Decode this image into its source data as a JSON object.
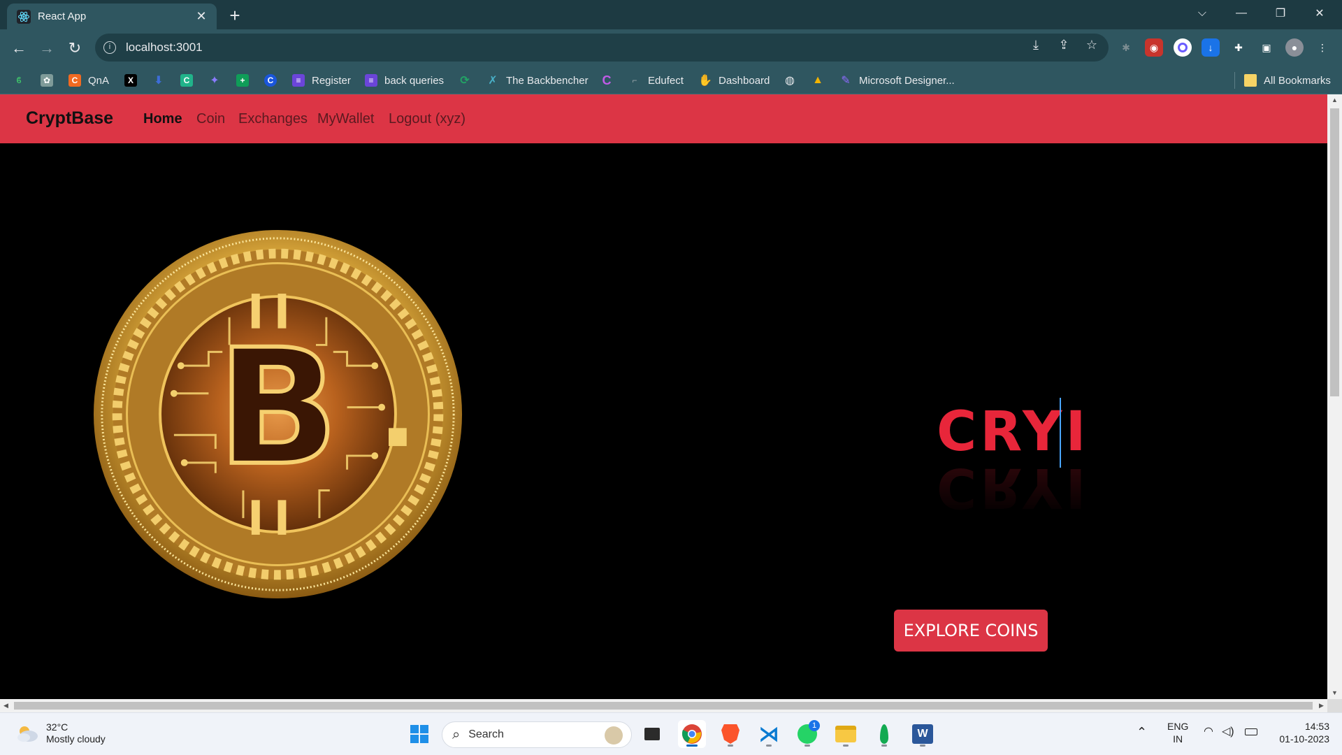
{
  "browser": {
    "tab_title": "React App",
    "url": "localhost:3001",
    "new_tab_symbol": "+",
    "bookmarks": [
      {
        "label": "",
        "icon": "leaf-icon",
        "color": "#3fbf6a"
      },
      {
        "label": "",
        "icon": "chatgpt-icon",
        "color": "#7f9b99"
      },
      {
        "label": "QnA",
        "icon": "c-orange-icon",
        "color": "#f26a21"
      },
      {
        "label": "",
        "icon": "x-icon",
        "color": "#000000"
      },
      {
        "label": "",
        "icon": "download-arrow-icon",
        "color": "#3d6dd8"
      },
      {
        "label": "",
        "icon": "c-green-icon",
        "color": "#21b38a"
      },
      {
        "label": "",
        "icon": "sparkle-icon",
        "color": "#8a7bff"
      },
      {
        "label": "",
        "icon": "sheet-plus-icon",
        "color": "#0f9d58"
      },
      {
        "label": "",
        "icon": "c-blue-icon",
        "color": "#1a56db"
      },
      {
        "label": "Register",
        "icon": "form-icon",
        "color": "#6b45d9"
      },
      {
        "label": "back queries",
        "icon": "form-icon",
        "color": "#6b45d9"
      },
      {
        "label": "",
        "icon": "refresh-green-icon",
        "color": "#22a565"
      },
      {
        "label": "The Backbencher",
        "icon": "figure-icon",
        "color": "#49b0c8"
      },
      {
        "label": "",
        "icon": "c-gradient-icon",
        "color": "#c25be8"
      },
      {
        "label": "Edufect",
        "icon": "edufect-icon",
        "color": "#9aa6ab"
      },
      {
        "label": "Dashboard",
        "icon": "hand-icon",
        "color": "#f4b400"
      },
      {
        "label": "",
        "icon": "globe-icon",
        "color": "#e8eaed"
      },
      {
        "label": "",
        "icon": "drive-icon",
        "color": "#f4b400"
      },
      {
        "label": "Microsoft Designer...",
        "icon": "designer-icon",
        "color": "#8f6bff"
      }
    ],
    "all_bookmarks": "All Bookmarks"
  },
  "app": {
    "brand": "CryptBase",
    "nav": [
      {
        "label": "Home",
        "active": true
      },
      {
        "label": "Coin",
        "active": false
      },
      {
        "label": "Exchanges",
        "active": false
      },
      {
        "label": "MyWallet",
        "active": false
      },
      {
        "label": "Logout (xyz)",
        "active": false
      }
    ],
    "hero_typed_text": "CRYI",
    "explore_button": "EXPLORE COINS",
    "accent_color": "#dc3545"
  },
  "taskbar": {
    "weather_temp": "32°C",
    "weather_desc": "Mostly cloudy",
    "search_placeholder": "Search",
    "lang_line1": "ENG",
    "lang_line2": "IN",
    "time": "14:53",
    "date": "01-10-2023",
    "whatsapp_badge": "1"
  }
}
